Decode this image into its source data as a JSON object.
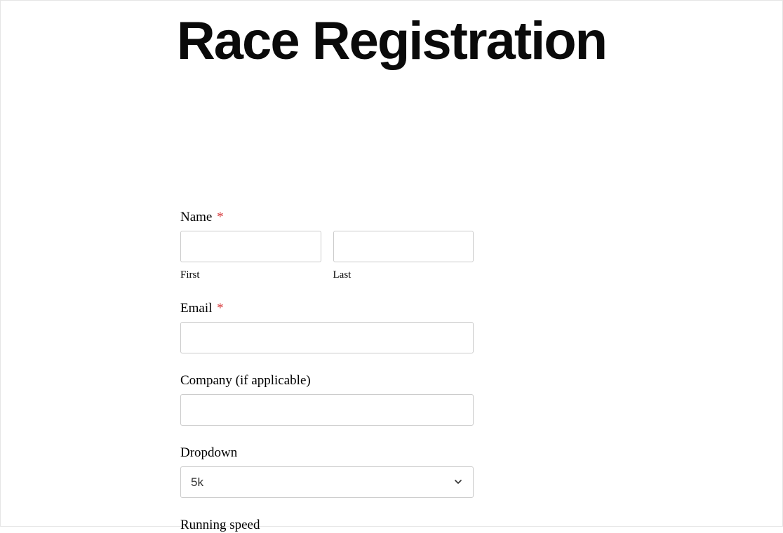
{
  "page": {
    "title": "Race Registration"
  },
  "form": {
    "name": {
      "label": "Name",
      "required": "*",
      "first_sublabel": "First",
      "last_sublabel": "Last",
      "first_value": "",
      "last_value": ""
    },
    "email": {
      "label": "Email",
      "required": "*",
      "value": ""
    },
    "company": {
      "label": "Company (if applicable)",
      "value": ""
    },
    "dropdown": {
      "label": "Dropdown",
      "selected": "5k"
    },
    "running_speed": {
      "label": "Running speed"
    }
  }
}
